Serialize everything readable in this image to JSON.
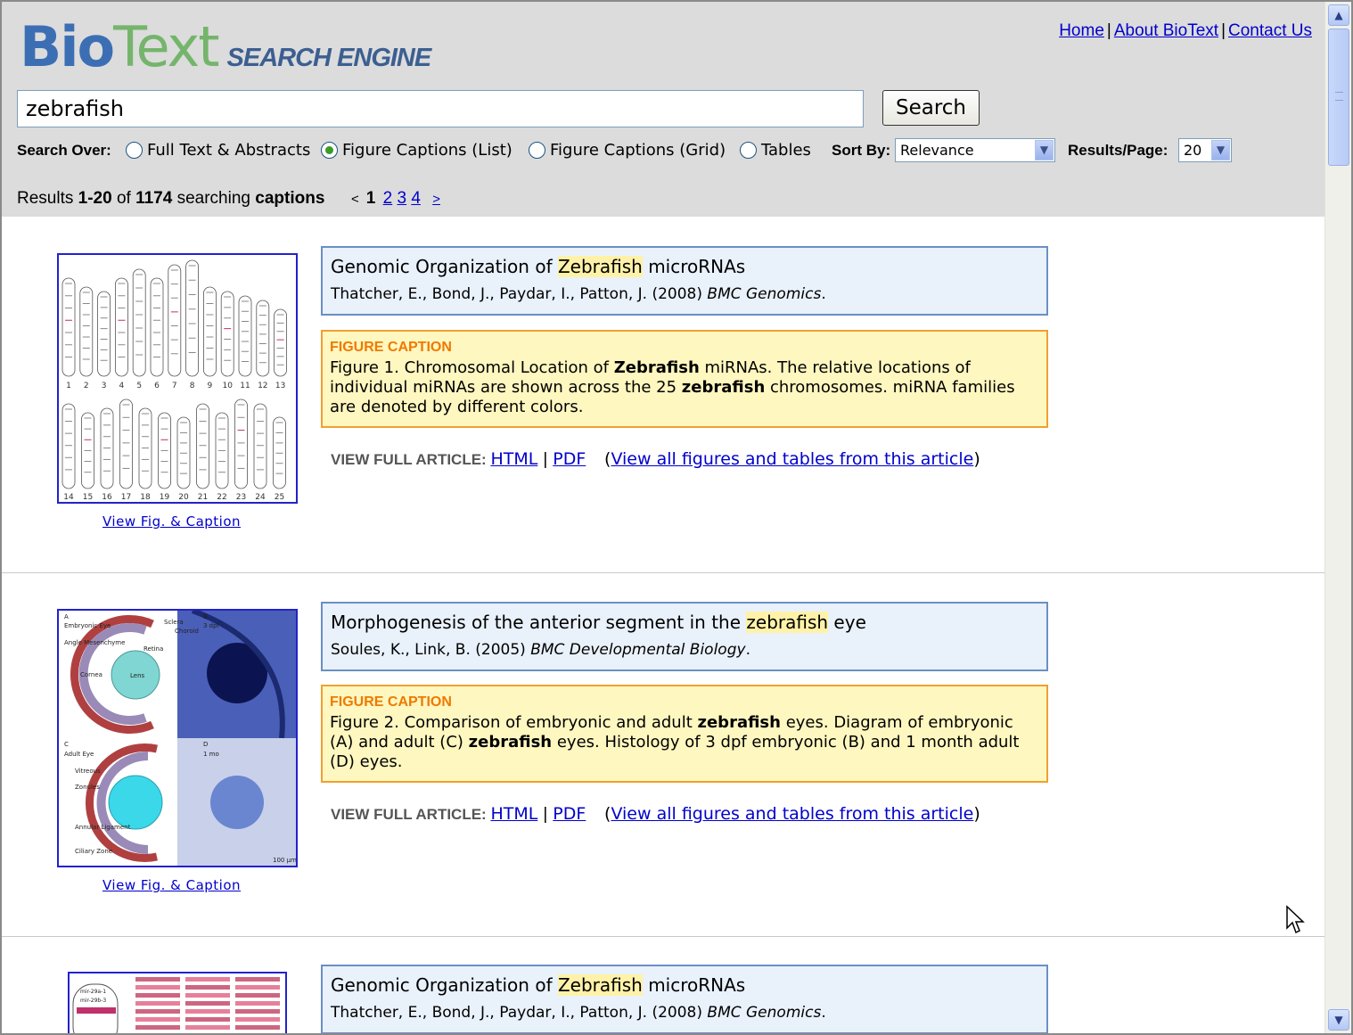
{
  "logo": {
    "bio": "Bio",
    "text": "Text",
    "engine": "SEARCH ENGINE"
  },
  "nav": {
    "home": "Home",
    "about": "About BioText",
    "contact": "Contact Us",
    "separator": "|"
  },
  "search": {
    "query": "zebrafish",
    "button_label": "Search"
  },
  "options": {
    "search_over_label": "Search Over:",
    "radios": [
      {
        "label": "Full Text & Abstracts",
        "selected": false
      },
      {
        "label": "Figure Captions (List)",
        "selected": true
      },
      {
        "label": "Figure Captions (Grid)",
        "selected": false
      },
      {
        "label": "Tables",
        "selected": false
      }
    ],
    "sort_by_label": "Sort By:",
    "sort_by_value": "Relevance",
    "results_per_page_label": "Results/Page:",
    "results_per_page_value": "20"
  },
  "results_summary": {
    "prefix": "Results ",
    "range": "1-20",
    "of": " of ",
    "total": "1174",
    "searching": " searching ",
    "target": "captions"
  },
  "pager": {
    "prev": "<",
    "current": "1",
    "pages": [
      "2",
      "3",
      "4"
    ],
    "next": ">"
  },
  "colors": {
    "header_bg": "#dcdcdc",
    "title_box_bg": "#e9f1fb",
    "caption_box_bg": "#fff7c0",
    "caption_label": "#ee7a00",
    "link": "#0000cc",
    "highlight": "#fff2a8"
  },
  "results": [
    {
      "title_before": "Genomic Organization of ",
      "title_highlight": "Zebrafish",
      "title_after": " microRNAs",
      "authors": "Thatcher, E., Bond, J., Paydar, I., Patton, J. (2008) ",
      "journal": "BMC Genomics",
      "journal_end": ".",
      "caption_label": "FIGURE CAPTION",
      "caption_parts": [
        {
          "t": "Figure 1. Chromosomal Location of ",
          "b": false
        },
        {
          "t": "Zebrafish",
          "b": true
        },
        {
          "t": " miRNAs. The relative locations of individual miRNAs are shown across the 25 ",
          "b": false
        },
        {
          "t": "zebrafish",
          "b": true
        },
        {
          "t": " chromosomes. miRNA families are denoted by different colors.",
          "b": false
        }
      ],
      "view_fig": "View Fig. & Caption",
      "full_article_label": "VIEW FULL ARTICLE:",
      "html_link": "HTML",
      "pdf_link": "PDF",
      "all_figs_link": "View all figures and tables from this article",
      "thumb_labels": [
        "1",
        "2",
        "3",
        "4",
        "5",
        "6",
        "7",
        "8",
        "9",
        "10",
        "11",
        "12",
        "13",
        "14",
        "15",
        "16",
        "17",
        "18",
        "19",
        "20",
        "21",
        "22",
        "23",
        "24",
        "25"
      ]
    },
    {
      "title_before": "Morphogenesis of the anterior segment in the ",
      "title_highlight": "zebrafish",
      "title_after": " eye",
      "authors": "Soules, K., Link, B. (2005) ",
      "journal": "BMC Developmental Biology",
      "journal_end": ".",
      "caption_label": "FIGURE CAPTION",
      "caption_parts": [
        {
          "t": "Figure 2. Comparison of embryonic and adult ",
          "b": false
        },
        {
          "t": "zebrafish",
          "b": true
        },
        {
          "t": " eyes. Diagram of embryonic (A) and adult (C) ",
          "b": false
        },
        {
          "t": "zebrafish",
          "b": true
        },
        {
          "t": " eyes. Histology of 3 dpf embryonic (B) and 1 month adult (D) eyes.",
          "b": false
        }
      ],
      "view_fig": "View Fig. & Caption",
      "full_article_label": "VIEW FULL ARTICLE:",
      "html_link": "HTML",
      "pdf_link": "PDF",
      "all_figs_link": "View all figures and tables from this article",
      "thumb_labels": [
        "A",
        "Embryonic Eye",
        "Sclera",
        "Choroid",
        "B",
        "3 dpf",
        "Retina",
        "Angle Mesenchyme",
        "Cornea",
        "Lens",
        "C",
        "Adult Eye",
        "D",
        "1 mo",
        "Vitreous",
        "Zonules",
        "Annular Ligament",
        "Ciliary Zone",
        "100 µm"
      ]
    },
    {
      "title_before": "Genomic Organization of ",
      "title_highlight": "Zebrafish",
      "title_after": " microRNAs",
      "authors": "Thatcher, E., Bond, J., Paydar, I., Patton, J. (2008) ",
      "journal": "BMC Genomics",
      "journal_end": ".",
      "thumb_labels": [
        "mir-29a-1",
        "mir-29b-3"
      ]
    }
  ]
}
